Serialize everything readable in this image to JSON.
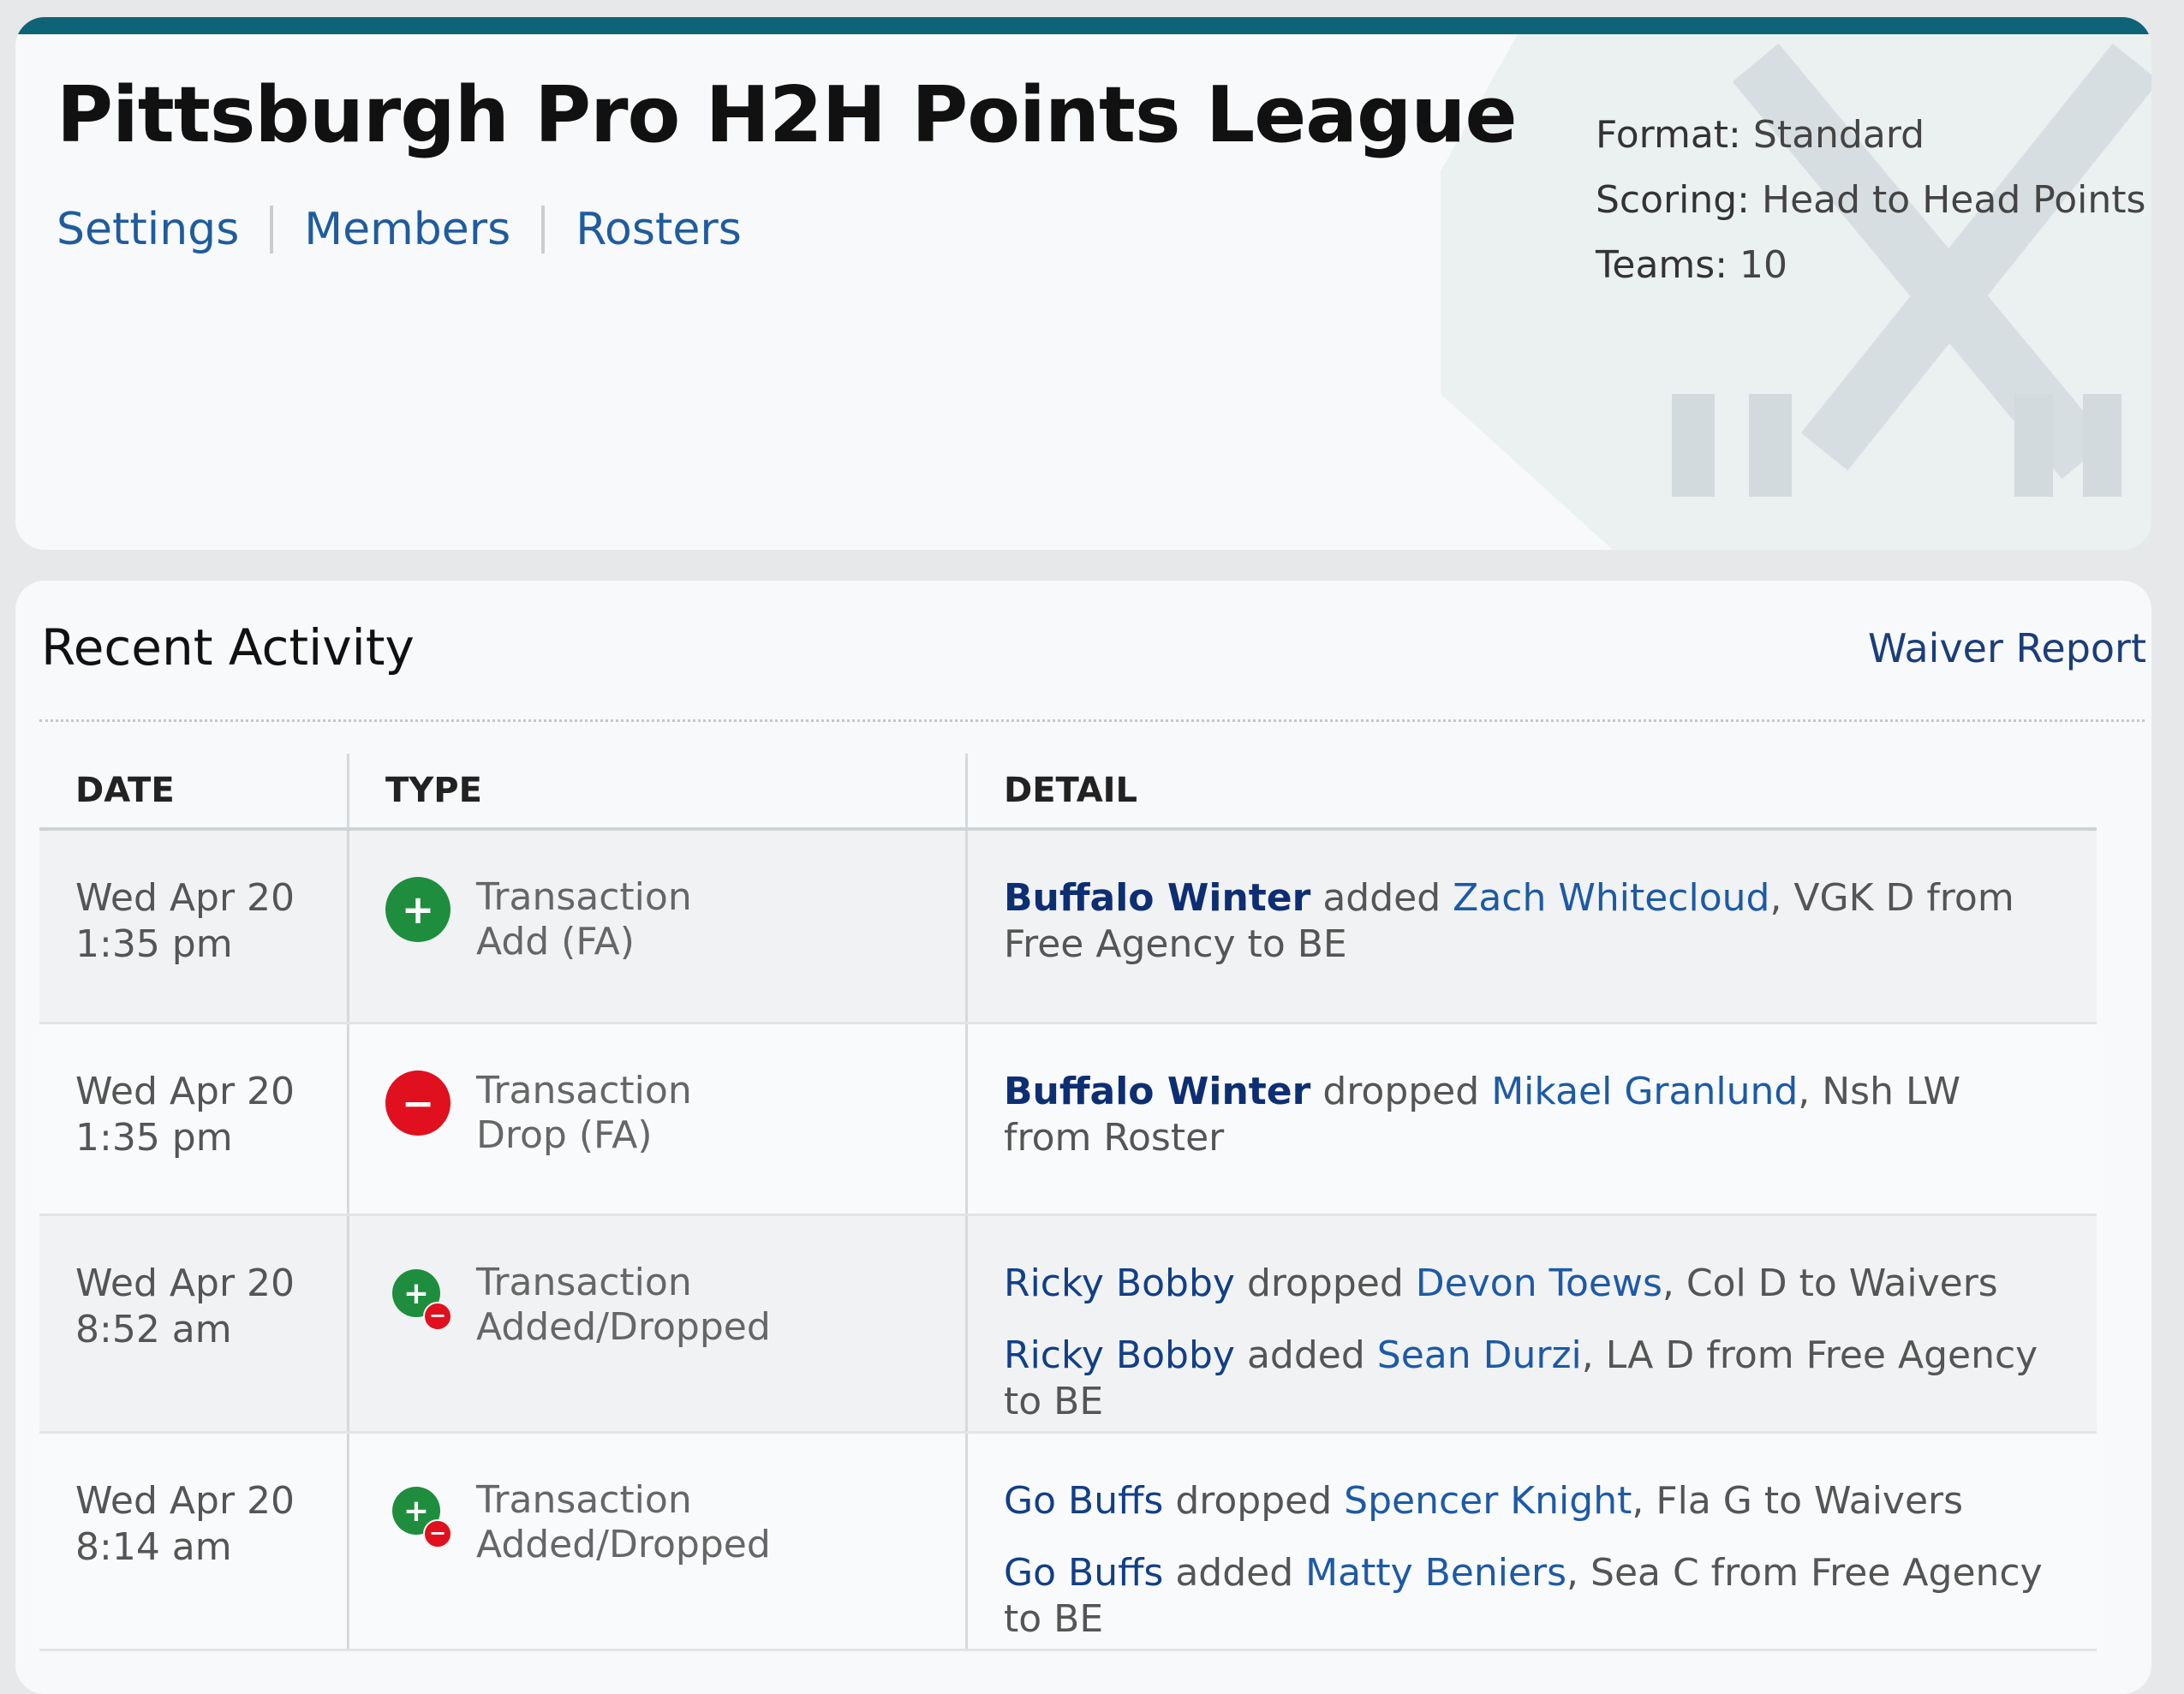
{
  "league": {
    "title": "Pittsburgh Pro H2H Points League",
    "nav": [
      "Settings",
      "Members",
      "Rosters"
    ],
    "format_label": "Format:",
    "format_value": "Standard",
    "scoring_label": "Scoring:",
    "scoring_value": "Head to Head Points",
    "teams_label": "Teams:",
    "teams_value": "10"
  },
  "activity": {
    "title": "Recent Activity",
    "waiver_link": "Waiver Report",
    "columns": [
      "DATE",
      "TYPE",
      "DETAIL"
    ],
    "rows": [
      {
        "date": "Wed Apr 20",
        "time": "1:35 pm",
        "type": "Transaction",
        "subtype": "Add (FA)",
        "lines": [
          {
            "team": "Buffalo Winter",
            "action": "added",
            "player": "Zach Whitecloud",
            "rest": ", VGK D from Free Agency to BE"
          }
        ]
      },
      {
        "date": "Wed Apr 20",
        "time": "1:35 pm",
        "type": "Transaction",
        "subtype": "Drop (FA)",
        "lines": [
          {
            "team": "Buffalo Winter",
            "action": "dropped",
            "player": "Mikael Granlund",
            "rest": ", Nsh LW from Roster"
          }
        ]
      },
      {
        "date": "Wed Apr 20",
        "time": "8:52 am",
        "type": "Transaction",
        "subtype": "Added/Dropped",
        "lines": [
          {
            "team": "Ricky Bobby",
            "action": "dropped",
            "player": "Devon Toews",
            "rest": ", Col D to Waivers"
          },
          {
            "team": "Ricky Bobby",
            "action": "added",
            "player": "Sean Durzi",
            "rest": ", LA D from Free Agency to BE"
          }
        ]
      },
      {
        "date": "Wed Apr 20",
        "time": "8:14 am",
        "type": "Transaction",
        "subtype": "Added/Dropped",
        "lines": [
          {
            "team": "Go Buffs",
            "action": "dropped",
            "player": "Spencer Knight",
            "rest": ", Fla G to Waivers"
          },
          {
            "team": "Go Buffs",
            "action": "added",
            "player": "Matty Beniers",
            "rest": ", Sea C from Free Agency to BE"
          }
        ]
      }
    ]
  },
  "icons": {
    "add": "plus-circle-icon",
    "drop": "minus-circle-icon",
    "added_dropped": "plus-minus-circle-icon",
    "logo": "hockey-sticks-logo"
  },
  "colors": {
    "topbar": "#0f6377",
    "link": "#1d5aa6",
    "add_green": "#1e8e3e",
    "drop_red": "#e0101e"
  }
}
